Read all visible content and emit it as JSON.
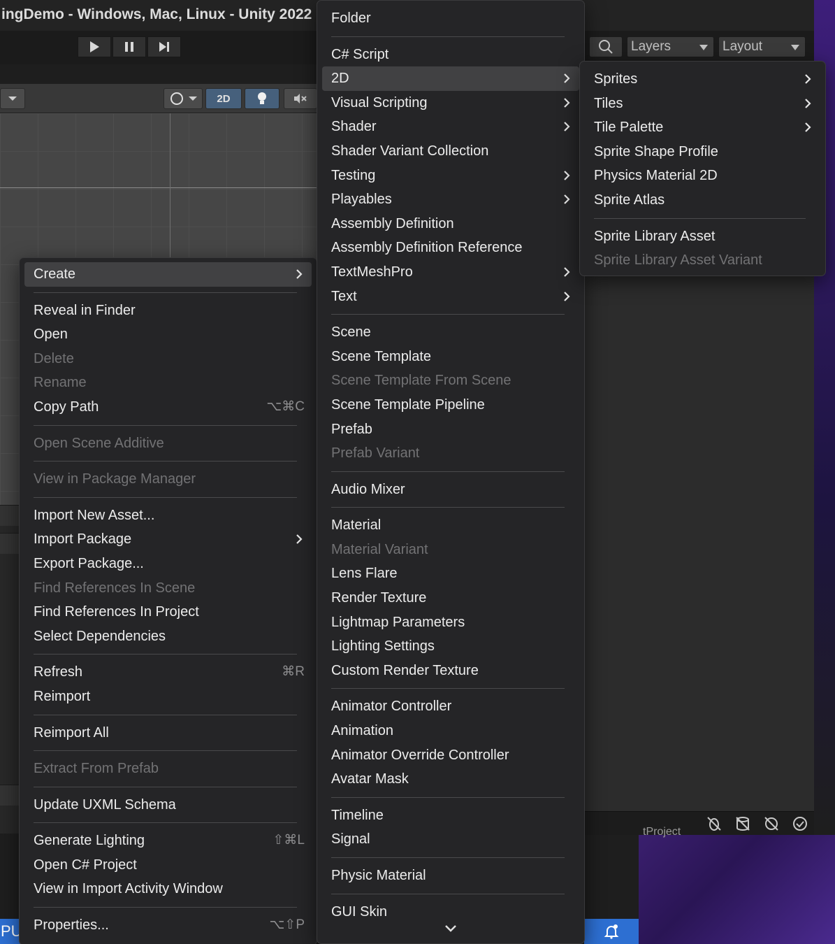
{
  "window": {
    "title": "ingDemo - Windows, Mac, Linux - Unity 2022"
  },
  "toolbar": {
    "play_icon": "play-icon",
    "pause_icon": "pause-icon",
    "step_icon": "step-forward-icon",
    "layers_label": "Layers",
    "layout_label": "Layout",
    "search_icon": "search-icon"
  },
  "scene_toolbar": {
    "mode_2d_label": "2D"
  },
  "bottom": {
    "left_tab_text": "PU",
    "project_label": "tProject"
  },
  "context_menu": {
    "items": [
      {
        "label": "Create",
        "submenu": true,
        "highlight": true
      },
      {
        "separator": true
      },
      {
        "label": "Reveal in Finder"
      },
      {
        "label": "Open"
      },
      {
        "label": "Delete",
        "disabled": true
      },
      {
        "label": "Rename",
        "disabled": true
      },
      {
        "label": "Copy Path",
        "shortcut": "⌥⌘C"
      },
      {
        "separator": true
      },
      {
        "label": "Open Scene Additive",
        "disabled": true
      },
      {
        "separator": true
      },
      {
        "label": "View in Package Manager",
        "disabled": true
      },
      {
        "separator": true
      },
      {
        "label": "Import New Asset..."
      },
      {
        "label": "Import Package",
        "submenu": true
      },
      {
        "label": "Export Package..."
      },
      {
        "label": "Find References In Scene",
        "disabled": true
      },
      {
        "label": "Find References In Project"
      },
      {
        "label": "Select Dependencies"
      },
      {
        "separator": true
      },
      {
        "label": "Refresh",
        "shortcut": "⌘R"
      },
      {
        "label": "Reimport"
      },
      {
        "separator": true
      },
      {
        "label": "Reimport All"
      },
      {
        "separator": true
      },
      {
        "label": "Extract From Prefab",
        "disabled": true
      },
      {
        "separator": true
      },
      {
        "label": "Update UXML Schema"
      },
      {
        "separator": true
      },
      {
        "label": "Generate Lighting",
        "shortcut": "⇧⌘L"
      },
      {
        "label": "Open C# Project"
      },
      {
        "label": "View in Import Activity Window"
      },
      {
        "separator": true
      },
      {
        "label": "Properties...",
        "shortcut": "⌥⇧P"
      }
    ]
  },
  "create_menu": {
    "items": [
      {
        "label": "Folder"
      },
      {
        "separator": true
      },
      {
        "label": "C# Script"
      },
      {
        "label": "2D",
        "submenu": true,
        "highlight": true
      },
      {
        "label": "Visual Scripting",
        "submenu": true
      },
      {
        "label": "Shader",
        "submenu": true
      },
      {
        "label": "Shader Variant Collection"
      },
      {
        "label": "Testing",
        "submenu": true
      },
      {
        "label": "Playables",
        "submenu": true
      },
      {
        "label": "Assembly Definition"
      },
      {
        "label": "Assembly Definition Reference"
      },
      {
        "label": "TextMeshPro",
        "submenu": true
      },
      {
        "label": "Text",
        "submenu": true
      },
      {
        "separator": true
      },
      {
        "label": "Scene"
      },
      {
        "label": "Scene Template"
      },
      {
        "label": "Scene Template From Scene",
        "disabled": true
      },
      {
        "label": "Scene Template Pipeline"
      },
      {
        "label": "Prefab"
      },
      {
        "label": "Prefab Variant",
        "disabled": true
      },
      {
        "separator": true
      },
      {
        "label": "Audio Mixer"
      },
      {
        "separator": true
      },
      {
        "label": "Material"
      },
      {
        "label": "Material Variant",
        "disabled": true
      },
      {
        "label": "Lens Flare"
      },
      {
        "label": "Render Texture"
      },
      {
        "label": "Lightmap Parameters"
      },
      {
        "label": "Lighting Settings"
      },
      {
        "label": "Custom Render Texture"
      },
      {
        "separator": true
      },
      {
        "label": "Animator Controller"
      },
      {
        "label": "Animation"
      },
      {
        "label": "Animator Override Controller"
      },
      {
        "label": "Avatar Mask"
      },
      {
        "separator": true
      },
      {
        "label": "Timeline"
      },
      {
        "label": "Signal"
      },
      {
        "separator": true
      },
      {
        "label": "Physic Material"
      },
      {
        "separator": true
      },
      {
        "label": "GUI Skin"
      }
    ],
    "scroll_icon": "chevron-down-icon"
  },
  "submenu_2d": {
    "items": [
      {
        "label": "Sprites",
        "submenu": true
      },
      {
        "label": "Tiles",
        "submenu": true
      },
      {
        "label": "Tile Palette",
        "submenu": true
      },
      {
        "label": "Sprite Shape Profile"
      },
      {
        "label": "Physics Material 2D"
      },
      {
        "label": "Sprite Atlas"
      },
      {
        "separator": true
      },
      {
        "label": "Sprite Library Asset"
      },
      {
        "label": "Sprite Library Asset Variant",
        "disabled": true
      }
    ]
  },
  "colors": {
    "menu_bg": "#252527",
    "highlight_bg": "#414143",
    "disabled_text": "#727274",
    "accent_blue": "#2d6fd2"
  }
}
